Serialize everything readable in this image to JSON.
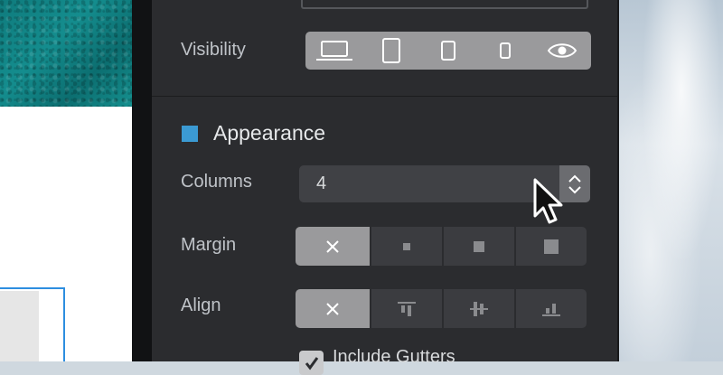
{
  "visibility": {
    "label": "Visibility",
    "options": [
      "desktop-icon",
      "tablet-icon",
      "tablet-small-icon",
      "phone-icon",
      "eye-icon"
    ]
  },
  "appearance": {
    "title": "Appearance",
    "swatch_color": "#3b9ad3"
  },
  "columns": {
    "label": "Columns",
    "value": "4"
  },
  "margin": {
    "label": "Margin",
    "options": [
      "none-x-icon",
      "small-square-icon",
      "medium-square-icon",
      "large-square-icon"
    ],
    "selected": 0
  },
  "align": {
    "label": "Align",
    "options": [
      "none-x-icon",
      "align-top-icon",
      "align-middle-icon",
      "align-bottom-icon"
    ],
    "selected": 0
  },
  "gutters": {
    "label": "Include Gutters",
    "checked": true
  },
  "colors": {
    "panel": "#2b2c2f",
    "selection": "#2d8ee0",
    "accent": "#3b9ad3"
  }
}
